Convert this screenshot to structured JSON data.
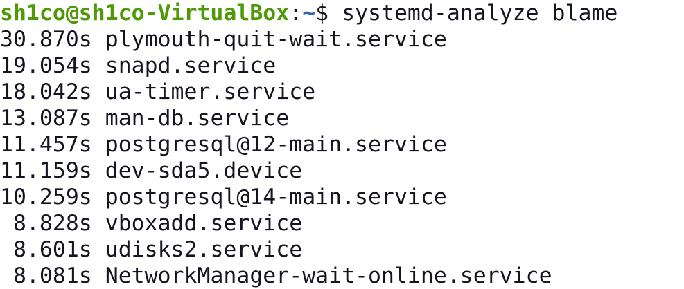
{
  "terminal": {
    "prompt": {
      "user_host": "sh1co@sh1co-VirtualBox",
      "separator": ":",
      "path": "~",
      "symbol": "$ ",
      "command": "systemd-analyze blame"
    },
    "rows": [
      {
        "time": "30.870s",
        "unit": "plymouth-quit-wait.service"
      },
      {
        "time": "19.054s",
        "unit": "snapd.service"
      },
      {
        "time": "18.042s",
        "unit": "ua-timer.service"
      },
      {
        "time": "13.087s",
        "unit": "man-db.service"
      },
      {
        "time": "11.457s",
        "unit": "postgresql@12-main.service"
      },
      {
        "time": "11.159s",
        "unit": "dev-sda5.device"
      },
      {
        "time": "10.259s",
        "unit": "postgresql@14-main.service"
      },
      {
        "time": " 8.828s",
        "unit": "vboxadd.service"
      },
      {
        "time": " 8.601s",
        "unit": "udisks2.service"
      },
      {
        "time": " 8.081s",
        "unit": "NetworkManager-wait-online.service"
      }
    ],
    "colors": {
      "background": "#ffffff",
      "foreground": "#171421",
      "user_host": "#4e9a06",
      "path": "#3465a4"
    }
  }
}
